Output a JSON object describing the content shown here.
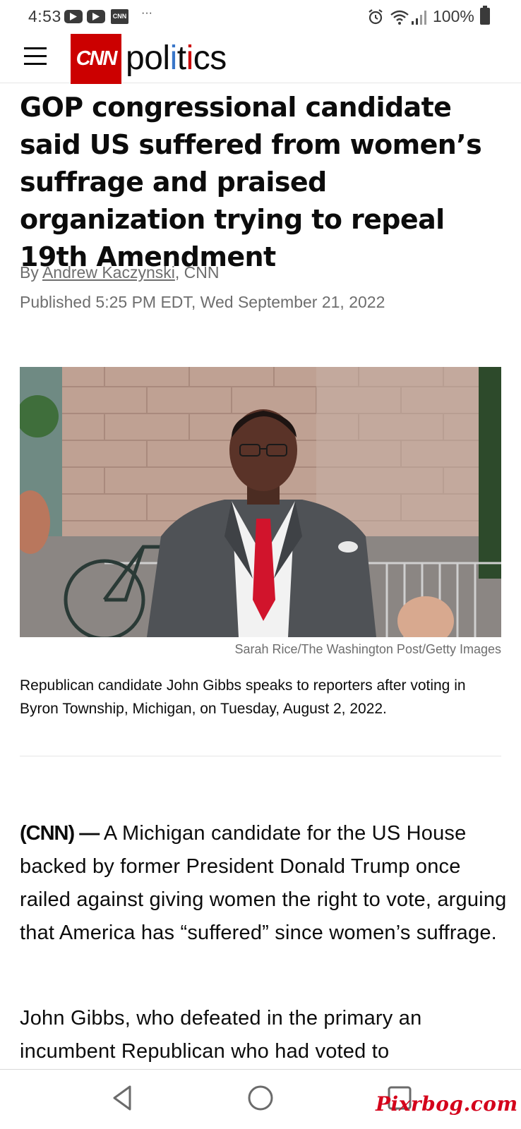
{
  "status_bar": {
    "time": "4:53",
    "notification_icons": [
      "youtube-icon",
      "youtube-icon",
      "cnn-app-icon"
    ],
    "cnn_mini": "CNN",
    "overflow": "···",
    "battery": "100%"
  },
  "header": {
    "logo_text": "CNN",
    "section_parts": [
      "pol",
      "i",
      "t",
      "i",
      "cs"
    ]
  },
  "article": {
    "headline": "GOP congressional candidate said US suffered from women’s suffrage and praised organization trying to repeal 19th Amendment",
    "byline_prefix": "By ",
    "author": "Andrew Kaczynski",
    "byline_suffix": ", CNN",
    "published": "Published 5:25 PM EDT, Wed September 21, 2022",
    "photo_credit": "Sarah Rice/The Washington Post/Getty Images",
    "caption": "Republican candidate John Gibbs speaks to reporters after voting in Byron Township, Michigan, on Tuesday, August 2, 2022.",
    "dateline": "(CNN) —",
    "paragraph_1": " A Michigan candidate for the US House backed by former President Donald Trump once railed against giving women the right to vote, arguing that America has “suffered” since women’s suffrage.",
    "paragraph_2": "John Gibbs, who defeated in the primary an incumbent Republican who had voted to"
  },
  "watermark": "Pixrbog.com",
  "colors": {
    "cnn_red": "#cc0000",
    "accent_blue": "#3976c9",
    "text": "#0c0c0c",
    "meta_gray": "#6e6e6e"
  }
}
